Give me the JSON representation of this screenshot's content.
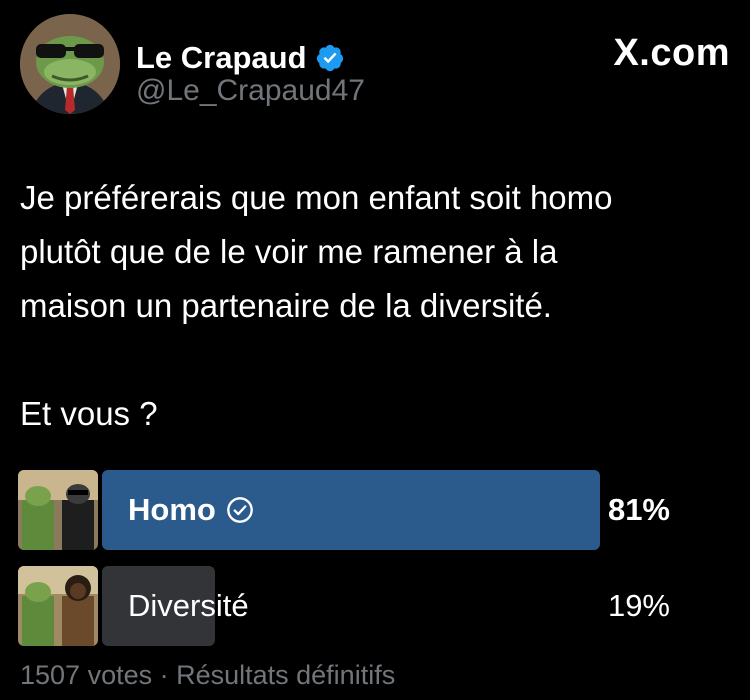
{
  "author": {
    "display_name": "Le Crapaud",
    "handle": "@Le_Crapaud47",
    "verified": true
  },
  "brand": {
    "logo_text": "X.com"
  },
  "tweet": {
    "text": "Je préférerais que mon enfant soit homo\nplutôt que de le voir me ramener à la\nmaison un partenaire de la diversité.\n\nEt vous ?"
  },
  "poll": {
    "options": [
      {
        "label": "Homo",
        "percent_label": "81%",
        "percent": 81,
        "selected": true,
        "winner": true
      },
      {
        "label": "Diversité",
        "percent_label": "19%",
        "percent": 19,
        "selected": false,
        "winner": false
      }
    ],
    "footer": "1507 votes · Résultats définitifs"
  },
  "colors": {
    "background": "#000000",
    "winner_bar": "#2b5a8c",
    "loser_bar": "#323438",
    "verified": "#1d9bf0",
    "secondary_text": "#71767b"
  }
}
